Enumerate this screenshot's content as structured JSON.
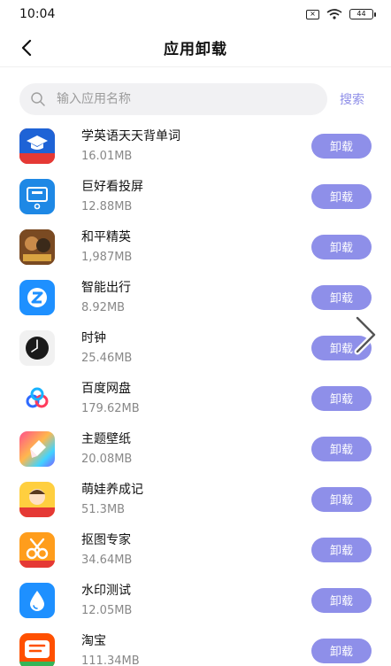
{
  "status": {
    "time": "10:04",
    "sim_label": "×",
    "battery": "44"
  },
  "nav": {
    "title": "应用卸载"
  },
  "search": {
    "placeholder": "输入应用名称",
    "button_label": "搜索"
  },
  "uninstall_label": "卸载",
  "apps": [
    {
      "name": "学英语天天背单词",
      "size": "16.01MB",
      "icon": "graduation-cap-icon",
      "color": "#e53935"
    },
    {
      "name": "巨好看投屏",
      "size": "12.88MB",
      "icon": "cast-screen-icon",
      "color": "#1e88e5"
    },
    {
      "name": "和平精英",
      "size": "1,987MB",
      "icon": "game-icon",
      "color": "#8d5524"
    },
    {
      "name": "智能出行",
      "size": "8.92MB",
      "icon": "travel-icon",
      "color": "#1e90ff"
    },
    {
      "name": "时钟",
      "size": "25.46MB",
      "icon": "clock-icon",
      "color": "#222222"
    },
    {
      "name": "百度网盘",
      "size": "179.62MB",
      "icon": "cloud-icon",
      "color": "#2f6bff"
    },
    {
      "name": "主题壁纸",
      "size": "20.08MB",
      "icon": "theme-icon",
      "color": "#7b61ff"
    },
    {
      "name": "萌娃养成记",
      "size": "51.3MB",
      "icon": "kid-icon",
      "color": "#f4a300"
    },
    {
      "name": "抠图专家",
      "size": "34.64MB",
      "icon": "cutout-icon",
      "color": "#ff8f00"
    },
    {
      "name": "水印测试",
      "size": "12.05MB",
      "icon": "water-drop-icon",
      "color": "#1e90ff"
    },
    {
      "name": "淘宝",
      "size": "111.34MB",
      "icon": "taobao-icon",
      "color": "#ff5000"
    }
  ]
}
